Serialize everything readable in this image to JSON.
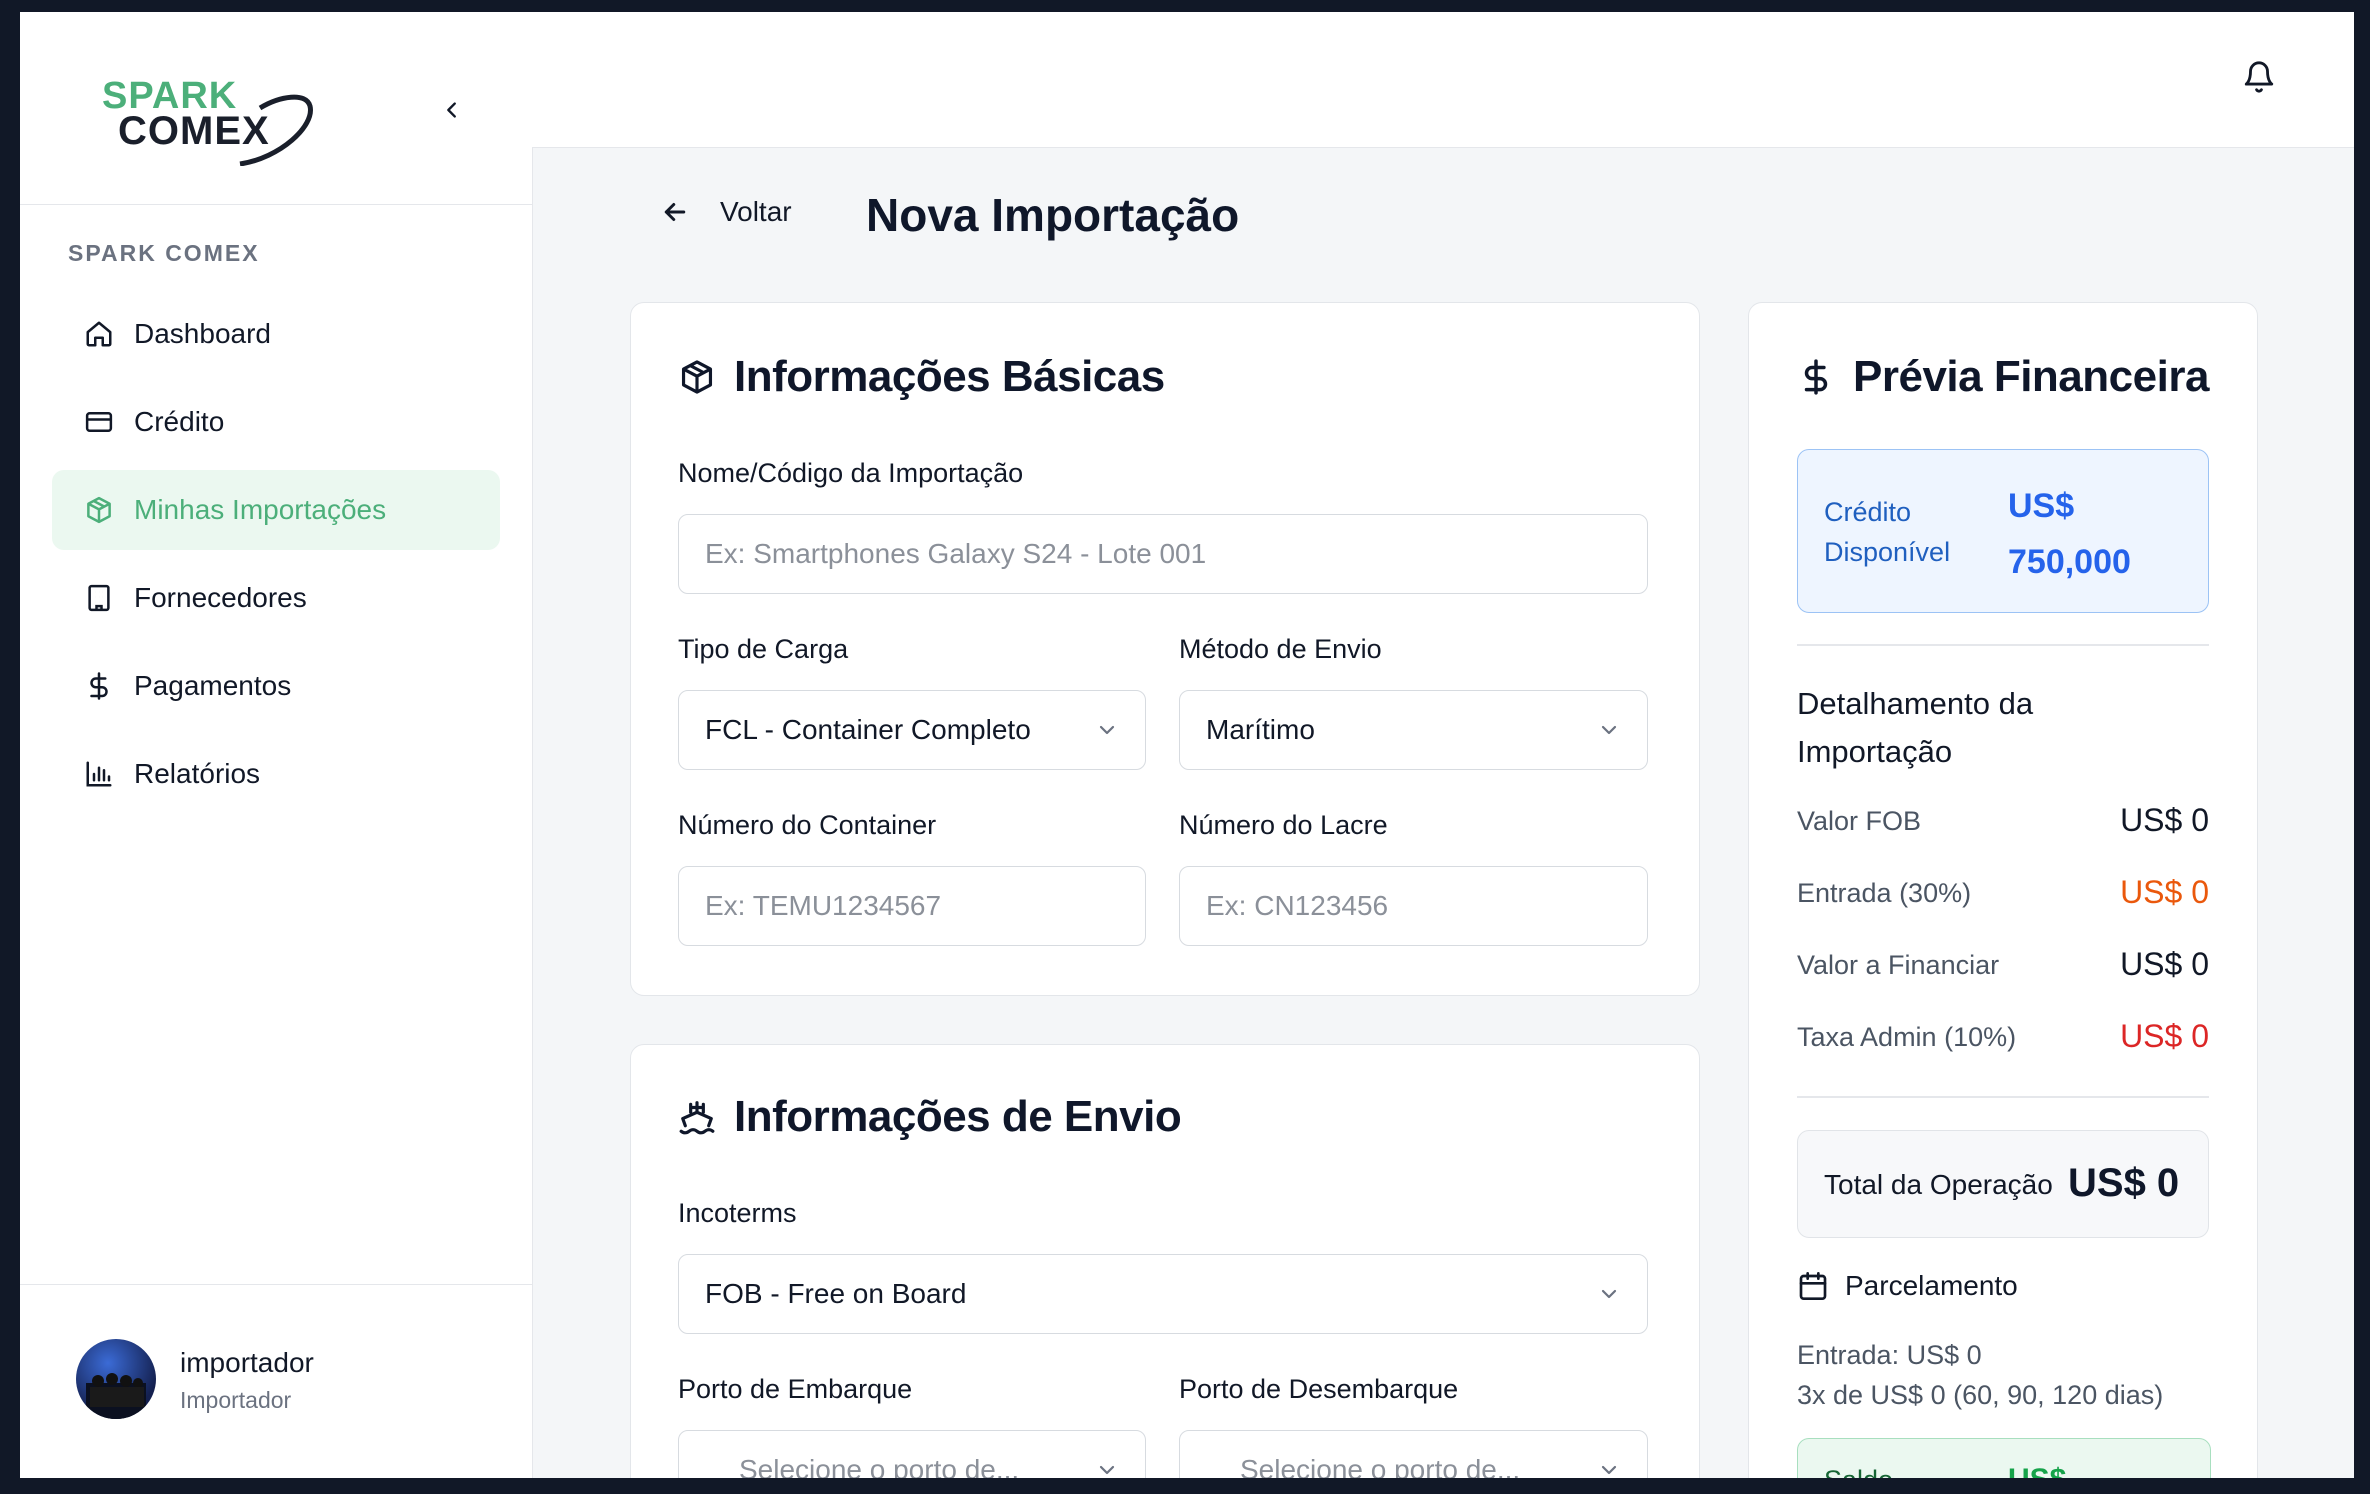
{
  "colors": {
    "brand_green": "#4caf7a",
    "logo_dark": "#1a1f2b",
    "accent_blue": "#2563eb",
    "orange": "#ea580c",
    "red": "#dc2626"
  },
  "sidebar": {
    "logo_line1": "SPARK",
    "logo_line2": "COMEX",
    "section_label": "SPARK COMEX",
    "items": [
      {
        "label": "Dashboard",
        "icon": "home-icon"
      },
      {
        "label": "Crédito",
        "icon": "credit-card-icon"
      },
      {
        "label": "Minhas Importações",
        "icon": "package-icon",
        "active": true
      },
      {
        "label": "Fornecedores",
        "icon": "building-icon"
      },
      {
        "label": "Pagamentos",
        "icon": "dollar-icon"
      },
      {
        "label": "Relatórios",
        "icon": "bar-chart-icon"
      }
    ],
    "user": {
      "name": "importador",
      "role": "Importador"
    }
  },
  "header": {
    "back_label": "Voltar",
    "title": "Nova Importação"
  },
  "basic_info": {
    "title": "Informações Básicas",
    "name_label": "Nome/Código da Importação",
    "name_placeholder": "Ex: Smartphones Galaxy S24 - Lote 001",
    "cargo_label": "Tipo de Carga",
    "cargo_value": "FCL - Container Completo",
    "method_label": "Método de Envio",
    "method_value": "Marítimo",
    "container_label": "Número do Container",
    "container_placeholder": "Ex: TEMU1234567",
    "seal_label": "Número do Lacre",
    "seal_placeholder": "Ex: CN123456"
  },
  "shipping_info": {
    "title": "Informações de Envio",
    "incoterms_label": "Incoterms",
    "incoterms_value": "FOB - Free on Board",
    "origin_label": "Porto de Embarque",
    "origin_placeholder": "Selecione o porto de...",
    "dest_label": "Porto de Desembarque",
    "dest_placeholder": "Selecione o porto de..."
  },
  "finance": {
    "title": "Prévia Financeira",
    "credit_label": "Crédito Disponível",
    "credit_value": "US$ 750,000",
    "detail_title": "Detalhamento da Importação",
    "rows": [
      {
        "label": "Valor FOB",
        "value": "US$ 0"
      },
      {
        "label": "Entrada (30%)",
        "value": "US$ 0"
      },
      {
        "label": "Valor a Financiar",
        "value": "US$ 0"
      },
      {
        "label": "Taxa Admin (10%)",
        "value": "US$ 0"
      }
    ],
    "total_label": "Total da Operação",
    "total_value": "US$ 0",
    "installment_title": "Parcelamento",
    "installment_entry": "Entrada: US$ 0",
    "installment_plan": "3x de US$ 0 (60, 90, 120 dias)",
    "saldo_label": "Saldo",
    "saldo_value": "US$"
  }
}
